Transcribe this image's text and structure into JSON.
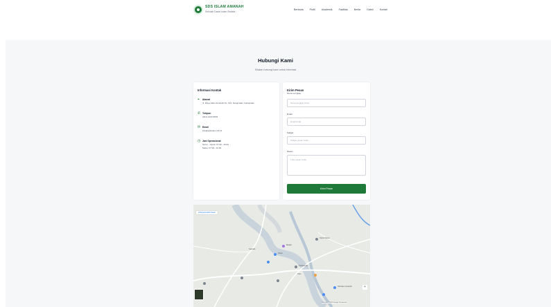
{
  "header": {
    "brand_name": "SDS ISLAM AMANAH",
    "brand_tagline": "Sekolah Dasar Islam Swasta",
    "nav": [
      "Beranda",
      "Profil",
      "Akademik",
      "Fasilitas",
      "Berita",
      "Galeri",
      "Kontak"
    ]
  },
  "page": {
    "title": "Hubungi Kami",
    "subtitle": "Silakan hubungi kami untuk informasi"
  },
  "info": {
    "title": "Informasi Kontak",
    "items": [
      {
        "icon": "map-pin-icon",
        "label": "Alamat",
        "value": "Jl. Raya Islam Amanah No. 123, Kecamatan, Kabupaten"
      },
      {
        "icon": "phone-icon",
        "label": "Telepon",
        "value": "(021) 1234 5678"
      },
      {
        "icon": "mail-icon",
        "label": "Email",
        "value": "info@sdsislam.sch.id"
      },
      {
        "icon": "clock-icon",
        "label": "Jam Operasional",
        "value": "Senin - Jumat: 07.00 - 15.00",
        "value2": "Sabtu: 07.00 - 12.00"
      }
    ]
  },
  "form": {
    "title": "Kirim Pesan",
    "subtitle": "Nama Lengkap",
    "name_placeholder": "Nama lengkap Anda",
    "email_label": "Email",
    "email_placeholder": "Email Anda",
    "subject_label": "Subjek",
    "subject_placeholder": "Subjek pesan Anda",
    "message_label": "Pesan",
    "message_placeholder": "Tulis pesan Anda",
    "submit_label": "Kirim Pesan"
  },
  "map": {
    "badge": "Lihat peta lebih besar",
    "attribution": "Data peta ©2024 Google  Persyaratan",
    "labels": [
      "Masjid",
      "Pasar",
      "Kantor Desa",
      "Sekolah",
      "Puskesmas",
      "SD Islam Amanah",
      "Toko"
    ],
    "zoom_symbol": "+"
  }
}
